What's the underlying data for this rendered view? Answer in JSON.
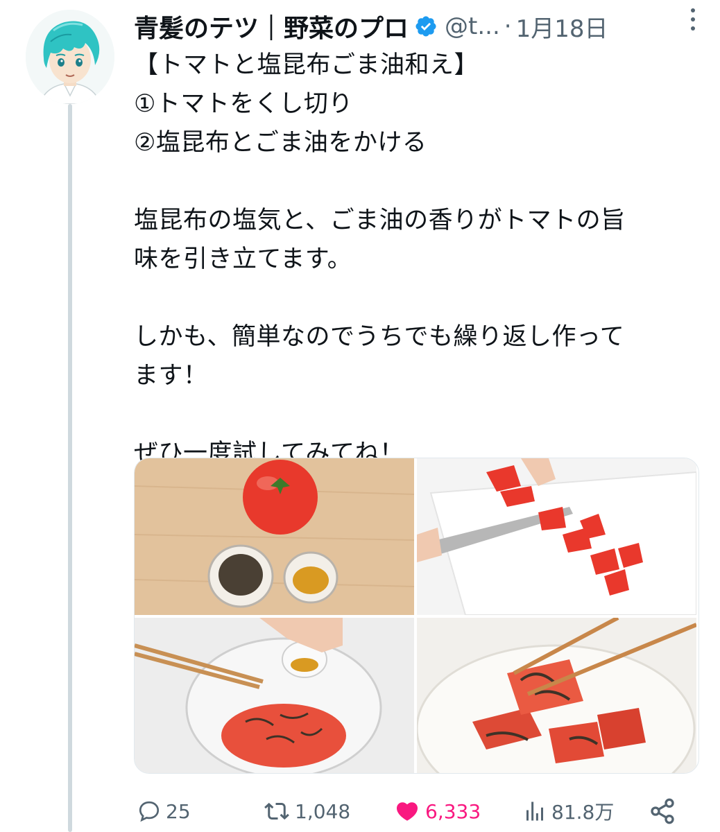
{
  "author": {
    "display_name": "青髪のテツ｜野菜のプロ",
    "handle": "@t...",
    "separator": "·",
    "date": "1月18日",
    "verified": true,
    "avatar_icon": "anime-avatar-blue-hair"
  },
  "tweet": {
    "lines": [
      "【トマトと塩昆布ごま油和え】",
      "①トマトをくし切り",
      "②塩昆布とごま油をかける",
      "",
      "塩昆布の塩気と、ごま油の香りがトマトの旨",
      "味を引き立てます。",
      "",
      "しかも、簡単なのでうちでも繰り返し作って",
      "ます！",
      "",
      "ぜひ一度試してみてね！"
    ]
  },
  "media": [
    {
      "icon": "photo-tomato-ingredients"
    },
    {
      "icon": "photo-cutting-tomato"
    },
    {
      "icon": "photo-mixing-bowl"
    },
    {
      "icon": "photo-chopsticks-tomato"
    }
  ],
  "actions": {
    "reply_count": "25",
    "retweet_count": "1,048",
    "like_count": "6,333",
    "views_count": "81.8万"
  },
  "colors": {
    "text": "#0f1419",
    "secondary": "#536471",
    "like": "#f91880",
    "verified": "#1d9bf0",
    "thread_line": "#cfd9de"
  }
}
